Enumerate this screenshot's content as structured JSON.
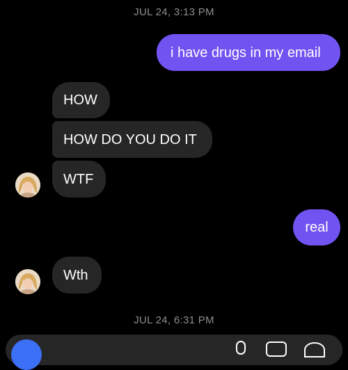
{
  "thread": {
    "timestamps": [
      "JUL 24, 3:13 PM",
      "JUL 24, 6:31 PM"
    ],
    "messages": [
      {
        "sender": "me",
        "text": "i have drugs in my email"
      },
      {
        "sender": "them",
        "text": "HOW"
      },
      {
        "sender": "them",
        "text": "HOW DO YOU DO IT"
      },
      {
        "sender": "them",
        "text": "WTF"
      },
      {
        "sender": "me",
        "text": "real"
      },
      {
        "sender": "them",
        "text": "Wth"
      }
    ]
  },
  "composer": {
    "icons": [
      "camera-icon",
      "microphone-icon",
      "gallery-icon",
      "sticker-icon"
    ]
  },
  "colors": {
    "background": "#000000",
    "outgoing_bubble": "#7153f2",
    "incoming_bubble": "#262626",
    "timestamp_text": "#8e8e93",
    "camera_button": "#3b6ff5"
  }
}
